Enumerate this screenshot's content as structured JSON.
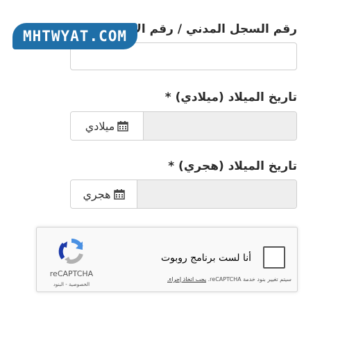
{
  "watermark": {
    "text": "MHTWYAT.COM"
  },
  "form": {
    "civil_label": "رقم السجل المدني / رقم الإقامة",
    "civil_value": "",
    "gregorian": {
      "label": "تاريخ الميلاد (ميلادي) *",
      "addon_text": "ميلادي",
      "icon": "calendar-icon",
      "value": ""
    },
    "hijri": {
      "label": "تاريخ الميلاد (هجري) *",
      "addon_text": "هجري",
      "icon": "calendar-icon",
      "value": ""
    }
  },
  "recaptcha": {
    "checkbox_label": "أنا لست برنامج روبوت",
    "brand": "reCAPTCHA",
    "privacy": "الخصوصية",
    "separator": "-",
    "terms": "البنود",
    "notice_text": "سيتم تغيير بنود خدمة reCAPTCHA.",
    "notice_link": "يجب اتخاذ إجراء."
  },
  "colors": {
    "watermark_bg": "#1f6fa8",
    "disabled_input_bg": "#eeeeee",
    "recaptcha_blue": "#4a90e2",
    "recaptcha_gray": "#b1b1b1"
  }
}
